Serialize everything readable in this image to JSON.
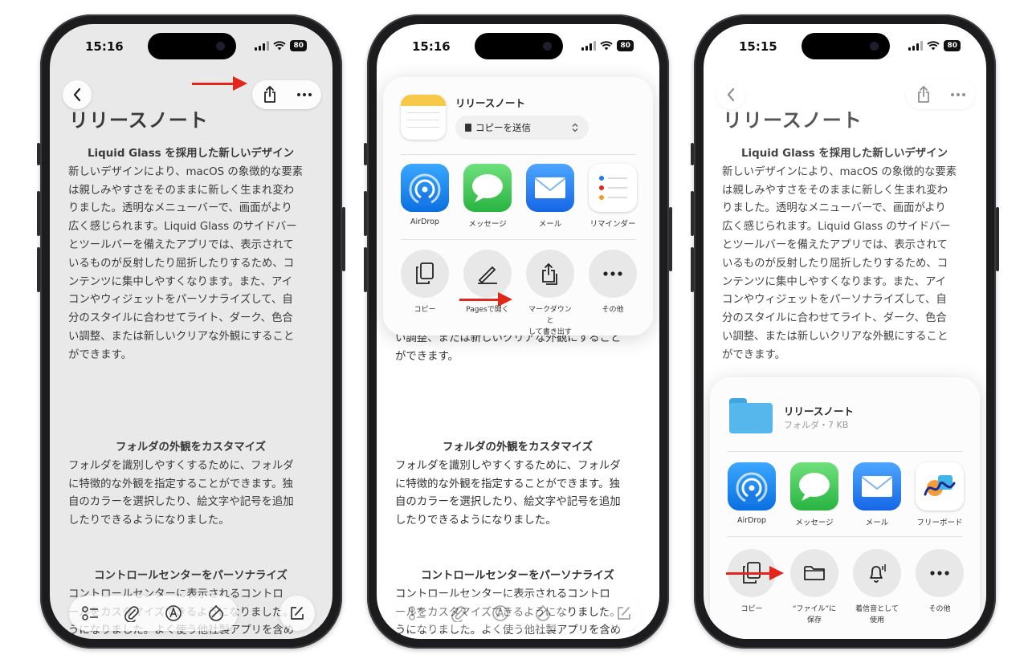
{
  "colors": {
    "accent_arrow": "#e3261c",
    "airdrop": "#1a8cf0",
    "messages": "#34c759",
    "mail": "#1f7bf2",
    "folder": "#56b7ec"
  },
  "status": {
    "time1": "15:16",
    "time2": "15:16",
    "time3": "15:15",
    "battery": "80"
  },
  "note": {
    "title": "リリースノート",
    "h1": "Liquid Glass を採用した新しいデザイン",
    "p1": [
      "新しいデザインにより、macOS の象徴的な要素",
      "は親しみやすさをそのままに新しく生まれ変わ",
      "りました。透明なメニューバーで、画面がより",
      "広く感じられます。Liquid Glass のサイドバー",
      "とツールバーを備えたアプリでは、表示されて",
      "いるものが反射したり屈折したりするため、コ",
      "ンテンツに集中しやすくなります。また、アイ",
      "コンやウィジェットをパーソナライズして、自",
      "分のスタイルに合わせてライト、ダーク、色合",
      "い調整、または新しいクリアな外観にすること",
      "ができます。"
    ],
    "h2": "フォルダの外観をカスタマイズ",
    "p2": [
      "フォルダを識別しやすくするために、フォルダ",
      "に特徴的な外観を指定することができます。独",
      "自のカラーを選択したり、絵文字や記号を追加",
      "したりできるようになりました。"
    ],
    "h3": "コントロールセンターをパーソナライズ",
    "p3": [
      "コントロールセンターに表示されるコントロ",
      "ールをカスタマイズできるようになりました。",
      "うになりました。よく使う他社製アプリを含め"
    ]
  },
  "sheet1": {
    "title": "リリースノート",
    "send_option": "コピーを送信",
    "apps": [
      "AirDrop",
      "メッセージ",
      "メール",
      "リマインダー"
    ],
    "actions": [
      {
        "l1": "コピー",
        "l2": ""
      },
      {
        "l1": "Pagesで開く",
        "l2": ""
      },
      {
        "l1": "マークダウンと",
        "l2": "して書き出す"
      },
      {
        "l1": "その他",
        "l2": ""
      }
    ]
  },
  "sheet2": {
    "title": "リリースノート",
    "subtitle": "フォルダ・7 KB",
    "apps": [
      "AirDrop",
      "メッセージ",
      "メール",
      "フリーボード"
    ],
    "actions": [
      {
        "l1": "コピー",
        "l2": ""
      },
      {
        "l1": "“ファイル”に",
        "l2": "保存"
      },
      {
        "l1": "着信音として",
        "l2": "使用"
      },
      {
        "l1": "その他",
        "l2": ""
      }
    ]
  }
}
